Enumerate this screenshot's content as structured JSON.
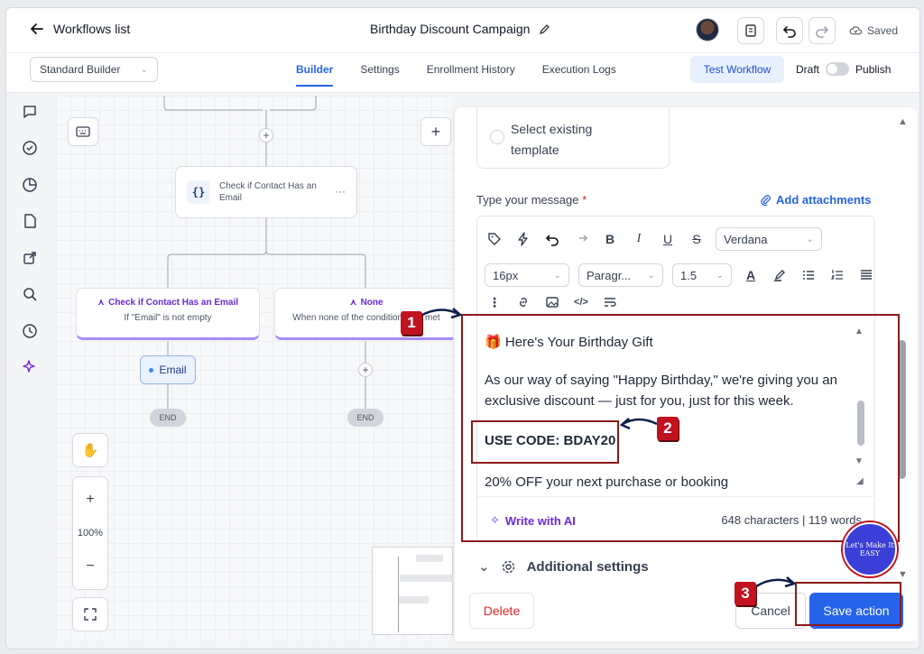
{
  "header": {
    "back_label": "Workflows list",
    "title": "Birthday Discount Campaign",
    "saved_label": "Saved"
  },
  "subbar": {
    "builder_select": "Standard Builder",
    "tabs": [
      "Builder",
      "Settings",
      "Enrollment History",
      "Execution Logs"
    ],
    "active_tab": "Builder",
    "test_button": "Test Workflow",
    "draft_label": "Draft",
    "publish_label": "Publish"
  },
  "canvas": {
    "check_node_label": "Check if Contact Has an Email",
    "branch_yes": {
      "title": "Check if Contact Has an Email",
      "subtitle": "If \"Email\" is not empty"
    },
    "branch_none": {
      "title": "None",
      "subtitle": "When none of the conditions are met"
    },
    "email_node": "Email",
    "end_label": "END",
    "zoom": "100%"
  },
  "panel": {
    "template_option": "Select existing template",
    "message_label": "Type your message",
    "required_mark": "*",
    "attach_label": "Add attachments",
    "font_family": "Verdana",
    "font_size": "16px",
    "paragraph": "Paragr...",
    "line_height": "1.5",
    "content": {
      "line1": "Here's Your Birthday Gift",
      "para": "As our way of saying \"Happy Birthday,\" we're giving you an exclusive discount — just for you, just for this week.",
      "code": "USE CODE: BDAY20",
      "offer": "20% OFF your next purchase or booking"
    },
    "write_ai": "Write with AI",
    "counts": "648 characters | 119 words",
    "additional_settings": "Additional settings",
    "delete_label": "Delete",
    "cancel_label": "Cancel",
    "save_label": "Save action"
  },
  "annotations": {
    "badge1": "1",
    "badge2": "2",
    "badge3": "3",
    "logo_text": "Let's Make It EASY"
  },
  "colors": {
    "accent": "#2563eb",
    "branch_purple": "#6d28d9",
    "annotation_red": "#c1121f"
  }
}
